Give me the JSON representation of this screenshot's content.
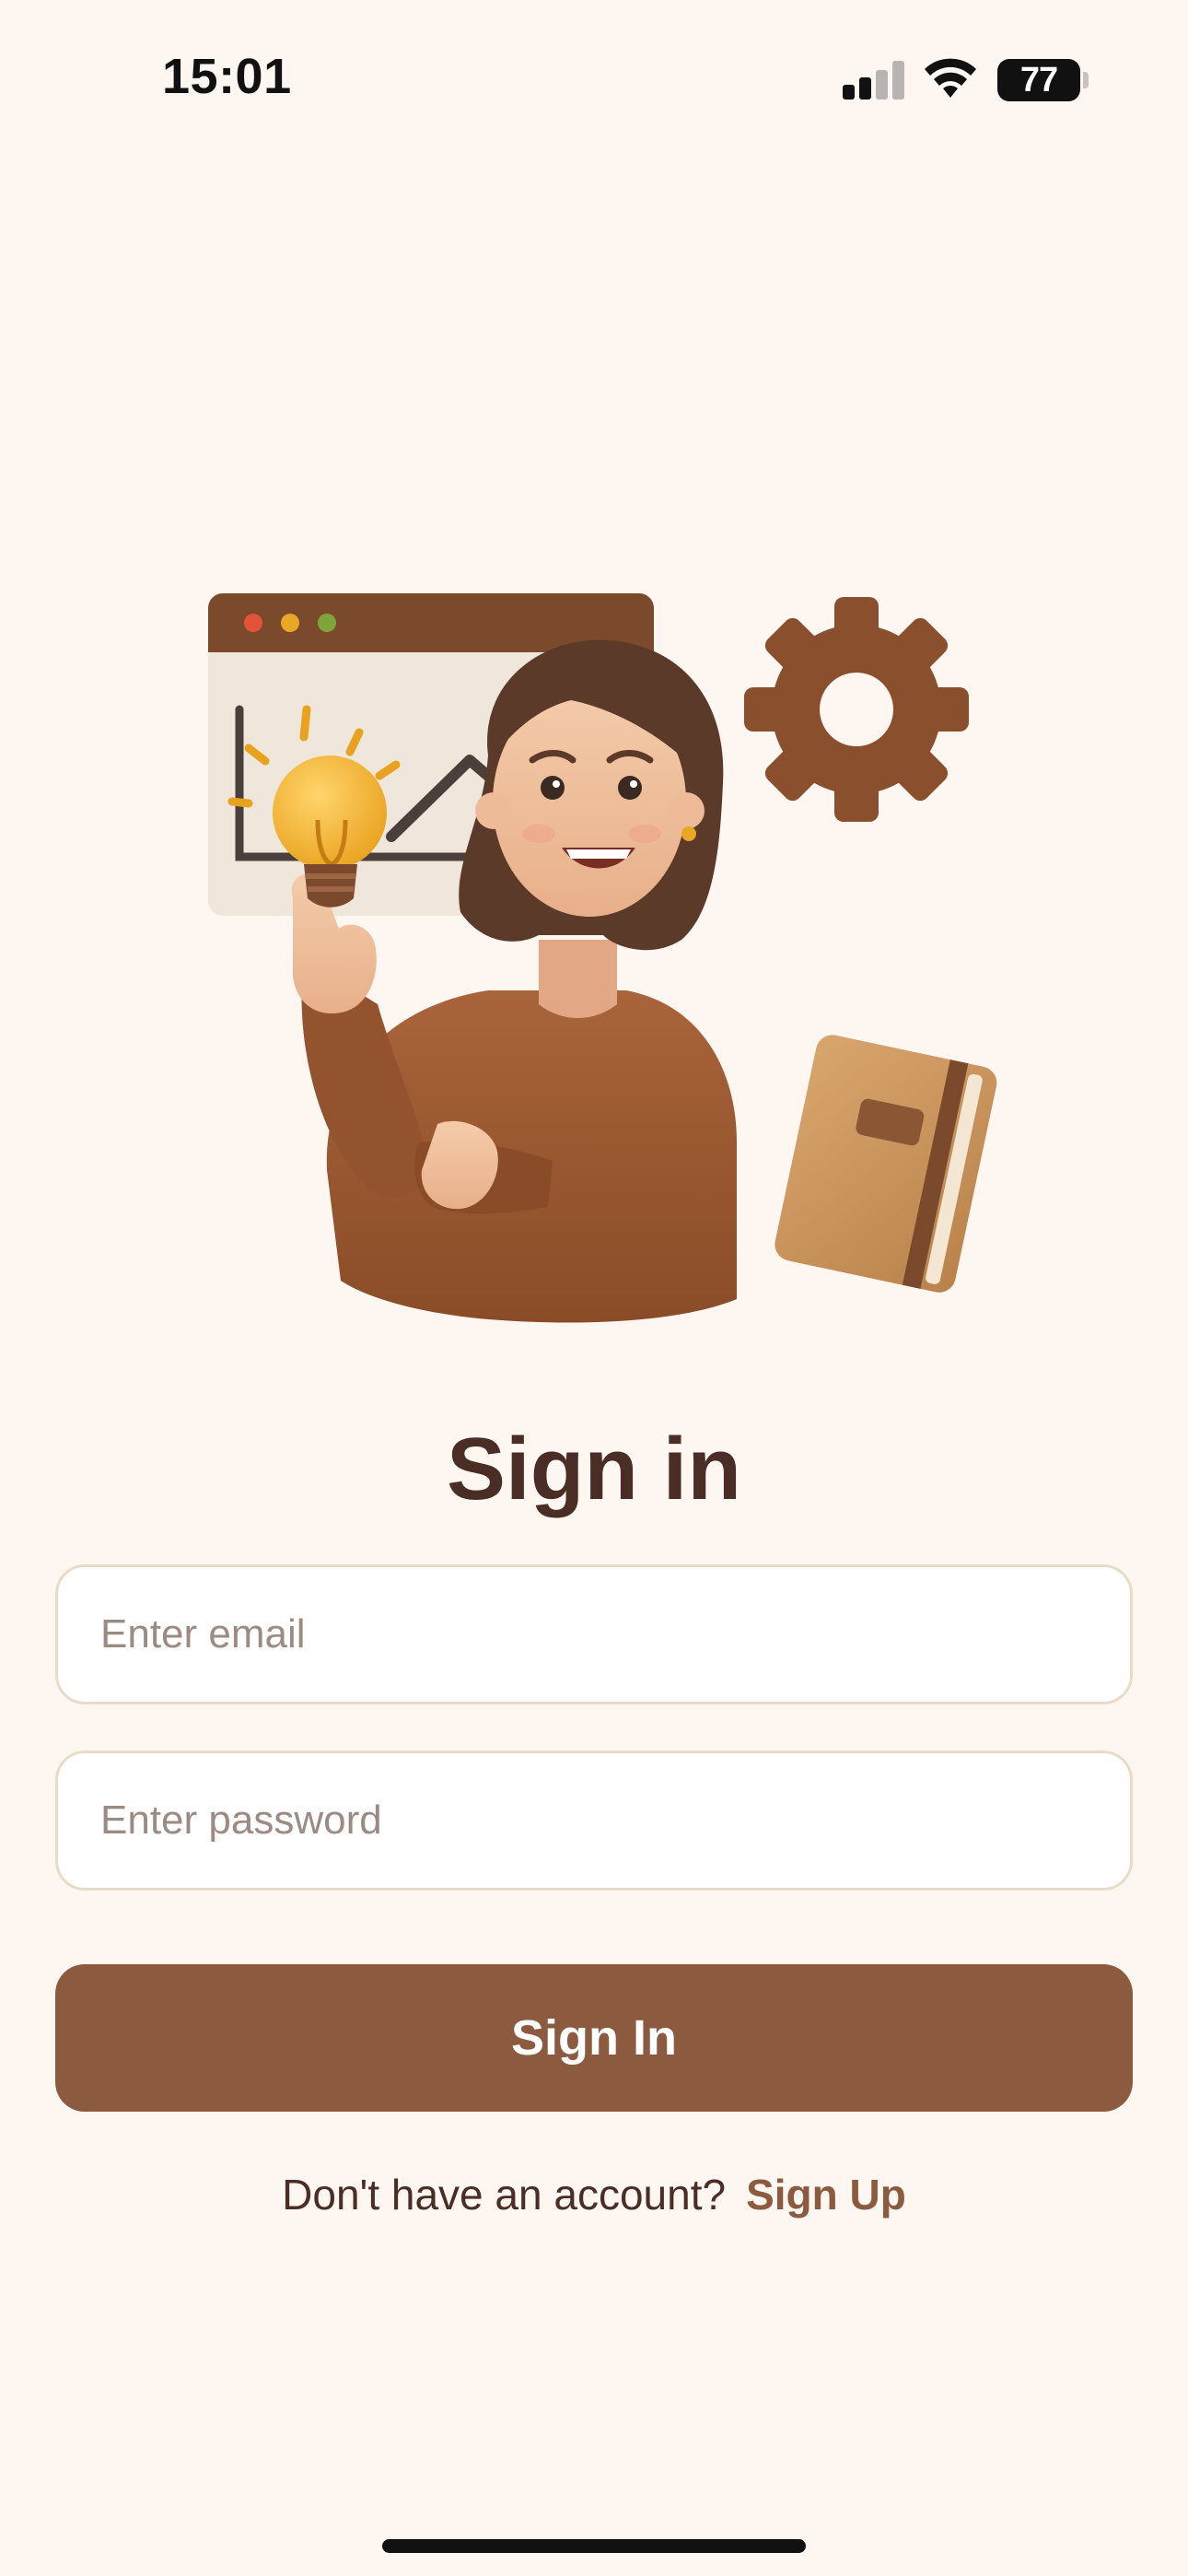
{
  "status_bar": {
    "time": "15:01",
    "battery": "77"
  },
  "title": "Sign in",
  "form": {
    "email_placeholder": "Enter email",
    "email_value": "",
    "password_placeholder": "Enter password",
    "password_value": "",
    "submit_label": "Sign In"
  },
  "footer": {
    "prompt": "Don't have an account?",
    "link_label": "Sign Up"
  },
  "colors": {
    "background": "#FDF6F1",
    "primary": "#8B5A3F",
    "heading": "#4A2E25",
    "field_border": "#E9DCC6"
  },
  "illustration": {
    "subject": "woman-with-lightbulb-chart-gear-notebook"
  }
}
